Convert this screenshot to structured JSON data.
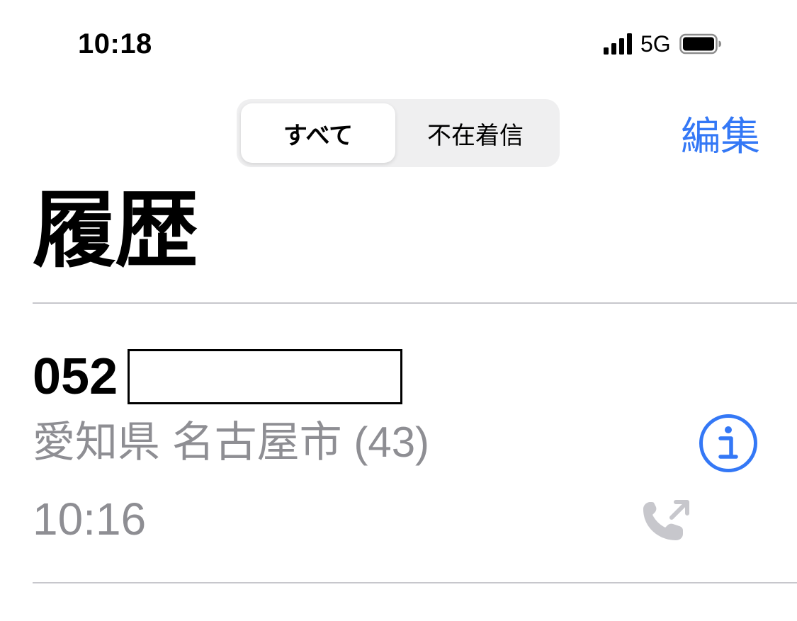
{
  "status_bar": {
    "time": "10:18",
    "network": "5G",
    "signal_bars": 4,
    "battery_level": 0.9
  },
  "segmented_control": {
    "all_label": "すべて",
    "missed_label": "不在着信",
    "selected": "all"
  },
  "nav": {
    "edit_label": "編集"
  },
  "title": "履歴",
  "calls": [
    {
      "number_prefix": "052",
      "location": "愛知県 名古屋市 (43)",
      "time": "10:16",
      "direction": "outgoing"
    }
  ],
  "colors": {
    "accent": "#3478f6",
    "secondary_text": "#8e8e93",
    "segment_bg": "#efeff0",
    "separator": "#c7c7cc",
    "call_icon": "#c7c7cc"
  },
  "icons": {
    "info": "info-circle-icon",
    "call_direction": "outgoing-call-icon",
    "signal": "cellular-signal-icon",
    "battery": "battery-icon"
  }
}
